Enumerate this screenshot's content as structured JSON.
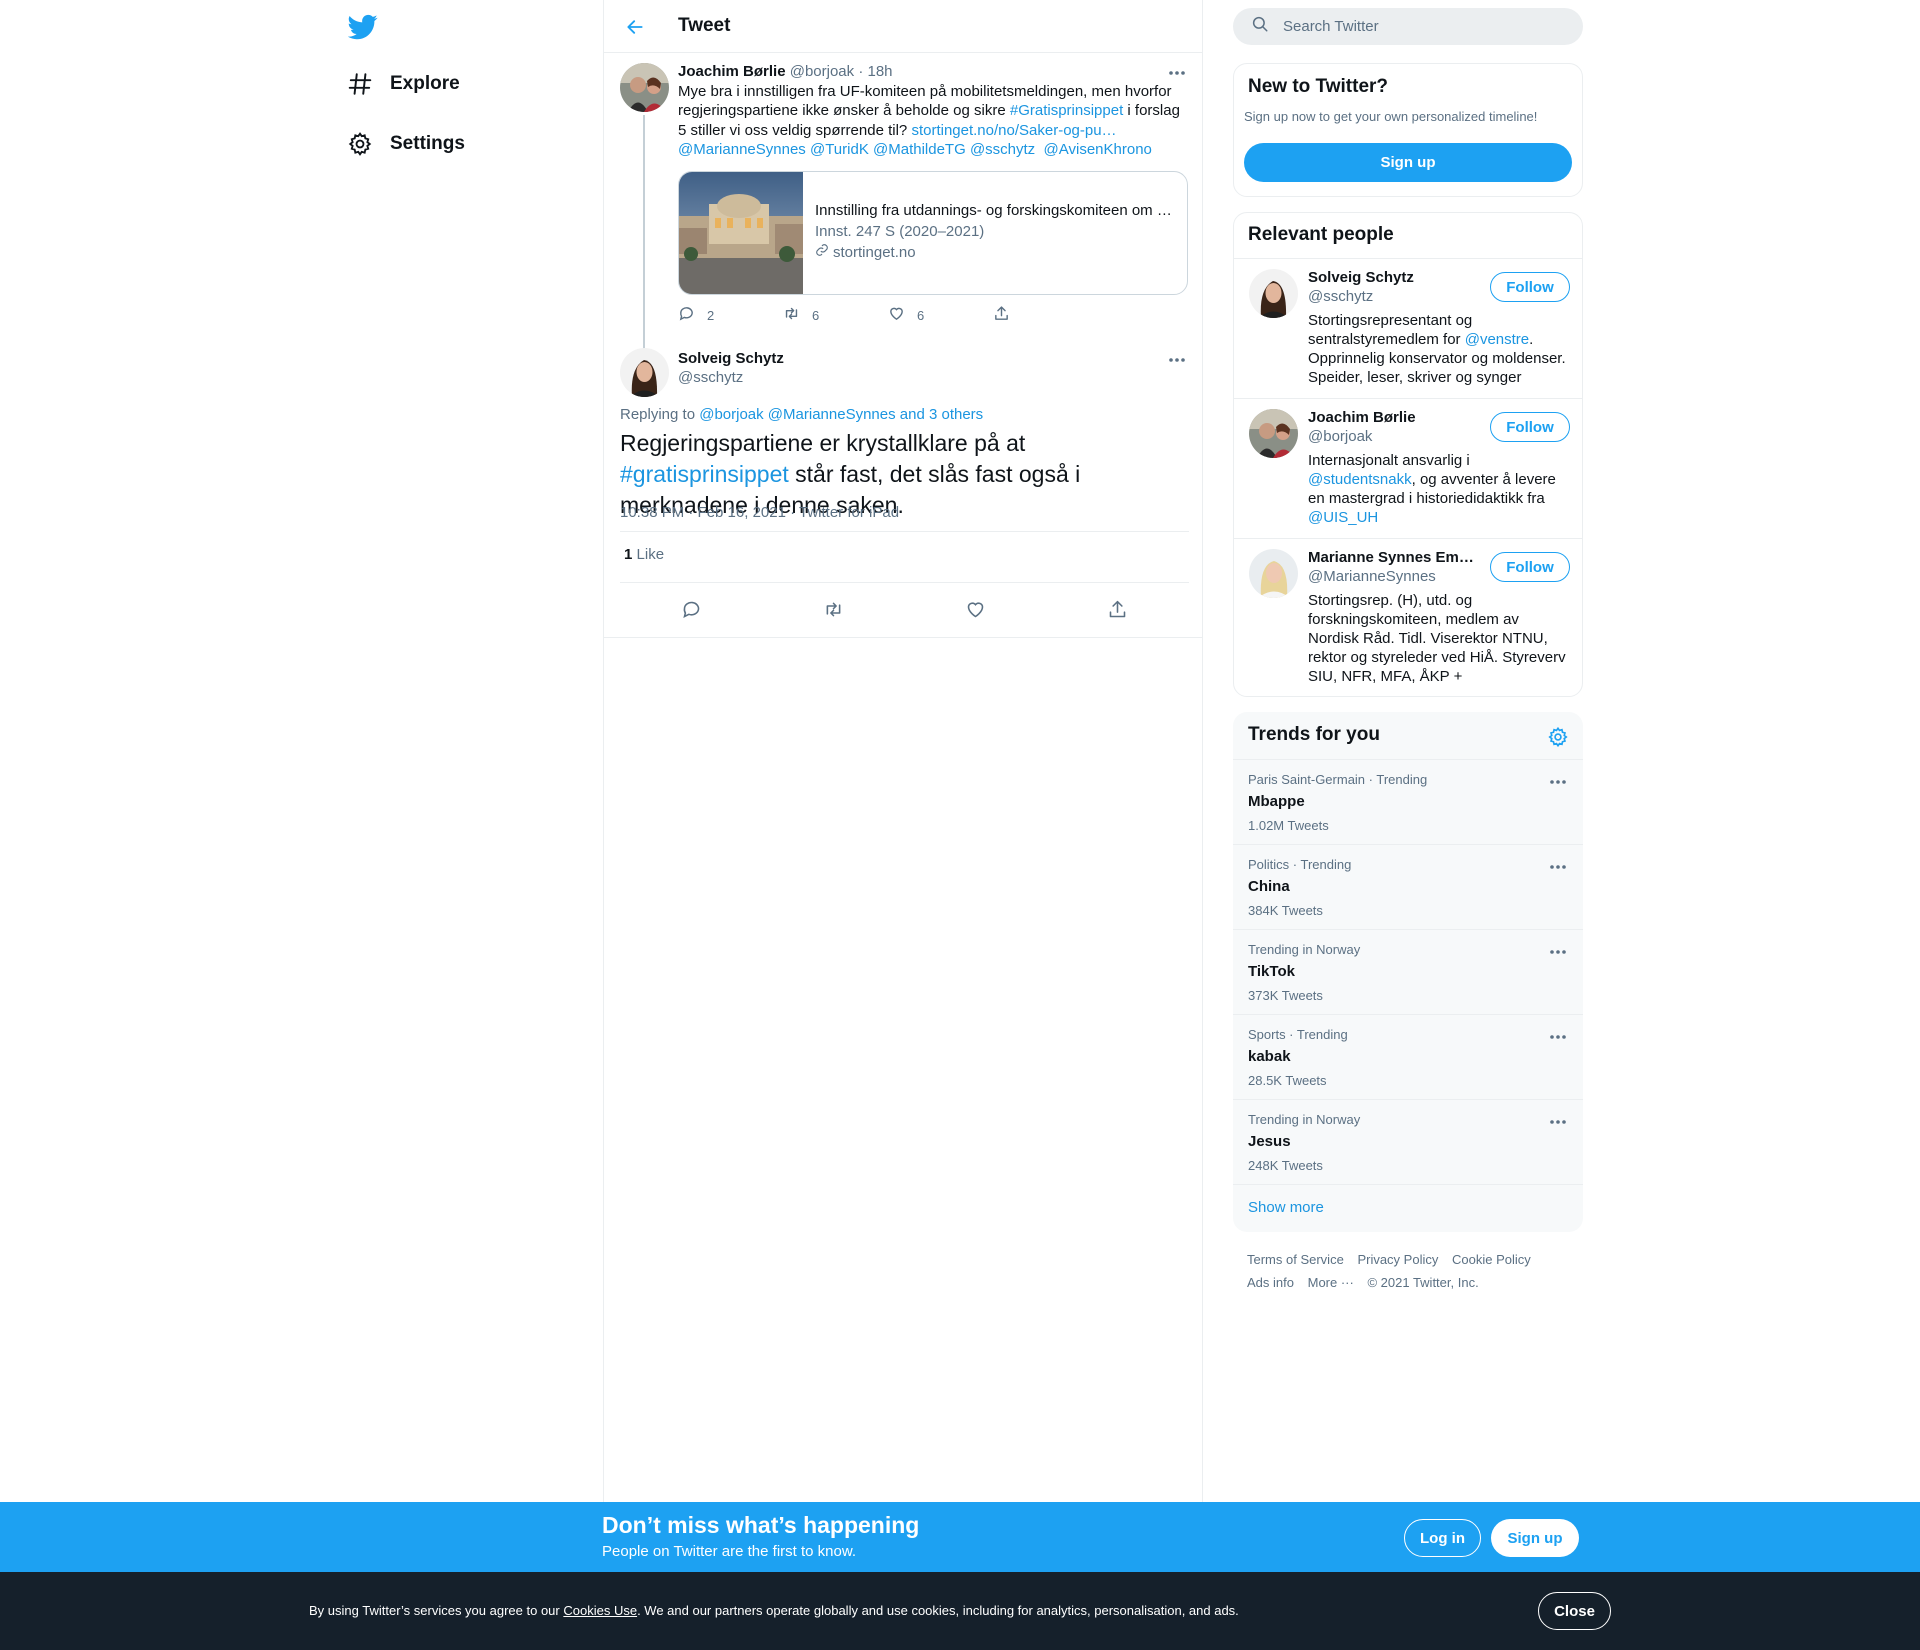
{
  "nav": {
    "items": [
      {
        "label": "Explore",
        "icon": "hashtag-icon"
      },
      {
        "label": "Settings",
        "icon": "gear-icon"
      }
    ]
  },
  "header": {
    "title": "Tweet"
  },
  "parent_tweet": {
    "name": "Joachim Børlie",
    "handle": "@borjoak",
    "time": "18h",
    "text_1": "Mye bra i innstilligen fra UF-komiteen på mobilitetsmeldingen, men hvorfor regjeringspartiene ikke ønsker å beholde og sikre ",
    "hashtag": "#Gratisprinsippet",
    "text_2": " i forslag 5 stiller vi oss veldig spørrende til? ",
    "link": "stortinget.no/no/Saker-og-pu…",
    "mentions": [
      "@MarianneSynnes",
      "@TuridK",
      "@MathildeTG",
      "@sschytz",
      "@AvisenKhrono"
    ],
    "card": {
      "title": "Innstilling fra utdannings- og forskingskomiteen om …",
      "subtitle": "Innst. 247 S (2020–2021)",
      "domain": "stortinget.no"
    },
    "replies": "2",
    "retweets": "6",
    "likes": "6"
  },
  "main_tweet": {
    "name": "Solveig Schytz",
    "handle": "@sschytz",
    "replying_label": "Replying to ",
    "replying_to": "@borjoak @MarianneSynnes and 3 others",
    "text_1": "Regjeringspartiene er krystallklare på at ",
    "hashtag": "#gratisprinsippet",
    "text_2": " står fast, det slås fast også i merknadene i denne saken.",
    "timestamp": "10:38 PM · Feb 16, 2021 · Twitter for iPad",
    "like_count": "1",
    "like_label": "Like"
  },
  "search": {
    "placeholder": "Search Twitter"
  },
  "new_to_twitter": {
    "title": "New to Twitter?",
    "subtitle": "Sign up now to get your own personalized timeline!",
    "button": "Sign up"
  },
  "relevant_people": {
    "title": "Relevant people",
    "follow_label": "Follow",
    "people": [
      {
        "name": "Solveig Schytz",
        "handle": "@sschytz",
        "bio_1": "Stortingsrepresentant og sentralstyremedlem for ",
        "bio_link": "@venstre",
        "bio_2": ". Opprinnelig konservator og moldenser. Speider, leser, skriver og synger"
      },
      {
        "name": "Joachim Børlie",
        "handle": "@borjoak",
        "bio_1": "Internasjonalt ansvarlig i ",
        "bio_link": "@studentsnakk",
        "bio_2": ", og avventer å levere en mastergrad i historiedidaktikk fra ",
        "bio_link_2": "@UIS_UH"
      },
      {
        "name": "Marianne Synnes Em…",
        "handle": "@MarianneSynnes",
        "bio_1": "Stortingsrep. (H), utd. og forskningskomiteen, medlem av Nordisk Råd. Tidl. Viserektor NTNU, rektor og styreleder ved HiÅ. Styreverv SIU, NFR, MFA, ÅKP +"
      }
    ]
  },
  "trends": {
    "title": "Trends for you",
    "items": [
      {
        "meta": "Paris Saint-Germain · Trending",
        "name": "Mbappe",
        "count": "1.02M Tweets"
      },
      {
        "meta": "Politics · Trending",
        "name": "China",
        "count": "384K Tweets"
      },
      {
        "meta": "Trending in Norway",
        "name": "TikTok",
        "count": "373K Tweets"
      },
      {
        "meta": "Sports · Trending",
        "name": "kabak",
        "count": "28.5K Tweets"
      },
      {
        "meta": "Trending in Norway",
        "name": "Jesus",
        "count": "248K Tweets"
      }
    ],
    "show_more": "Show more"
  },
  "footer": {
    "links": [
      "Terms of Service",
      "Privacy Policy",
      "Cookie Policy",
      "Ads info",
      "More ···"
    ],
    "copyright": "© 2021 Twitter, Inc."
  },
  "signup_banner": {
    "title": "Don’t miss what’s happening",
    "subtitle": "People on Twitter are the first to know.",
    "login": "Log in",
    "signup": "Sign up"
  },
  "cookie_bar": {
    "text_1": "By using Twitter’s services you agree to our ",
    "link": "Cookies Use",
    "text_2": ". We and our partners operate globally and use cookies, including for analytics, personalisation, and ads.",
    "close": "Close"
  },
  "colors": {
    "accent": "#1da1f2",
    "link": "#1b95e0",
    "muted": "#5b7083",
    "cookie_bg": "#15202b"
  }
}
